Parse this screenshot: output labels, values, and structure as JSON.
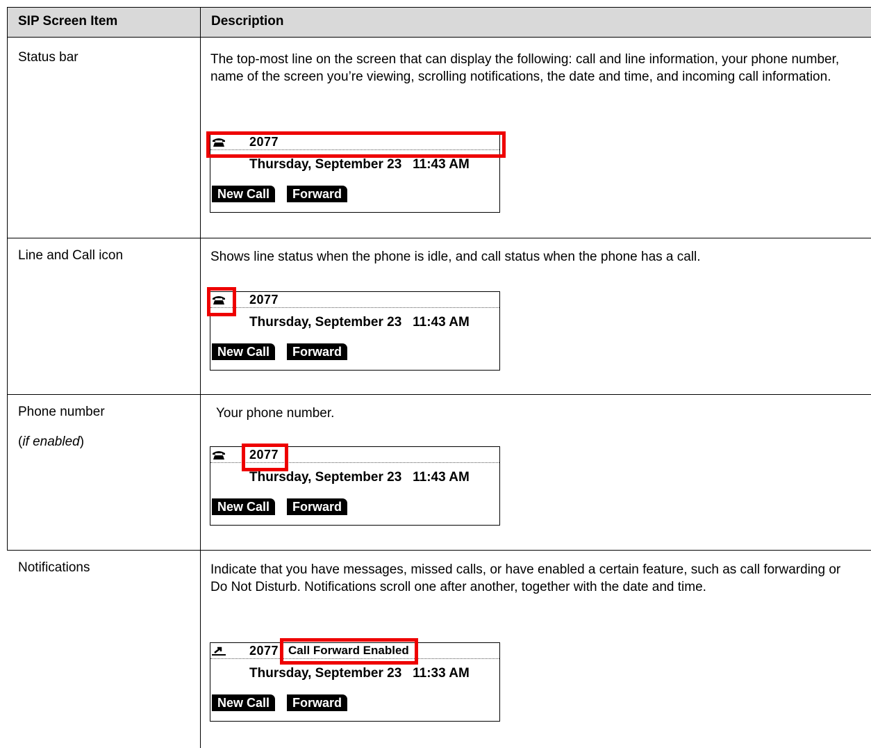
{
  "header": {
    "col1": "SIP Screen Item",
    "col2": "Description"
  },
  "rows": [
    {
      "item": "Status bar",
      "description": "The top-most line on the screen that can display the following: call and line information, your phone number, name of the screen you’re viewing, scrolling notifications, the date and time, and incoming call information.",
      "screen": {
        "number": "2077",
        "date": "Thursday, September 23",
        "time": "11:43 AM",
        "softkey1": "New Call",
        "softkey2": "Forward",
        "status_icon": "handset-icon"
      }
    },
    {
      "item": "Line and Call icon",
      "description": "Shows line status when the phone is idle, and call status when the phone has a call.",
      "screen": {
        "number": "2077",
        "date": "Thursday, September 23",
        "time": "11:43 AM",
        "softkey1": "New Call",
        "softkey2": "Forward",
        "status_icon": "handset-icon"
      }
    },
    {
      "item": "Phone number",
      "item_note_open": "(",
      "item_note": "if enabled",
      "item_note_close": ")",
      "description": "Your phone number.",
      "screen": {
        "number": "2077",
        "date": "Thursday, September 23",
        "time": "11:43 AM",
        "softkey1": "New Call",
        "softkey2": "Forward",
        "status_icon": "handset-icon"
      }
    },
    {
      "item": "Notifications",
      "description": "Indicate that you have messages, missed calls, or have enabled a certain feature, such as call forwarding or Do Not Disturb. Notifications scroll one after another, together with the date and time.",
      "screen": {
        "number": "2077",
        "notification": "Call Forward Enabled",
        "date": "Thursday, September 23",
        "time": "11:33 AM",
        "softkey1": "New Call",
        "softkey2": "Forward",
        "status_icon": "forward-arrow-icon"
      }
    }
  ],
  "colors": {
    "header_bg": "#d9d9d9",
    "highlight": "#ee0000"
  }
}
